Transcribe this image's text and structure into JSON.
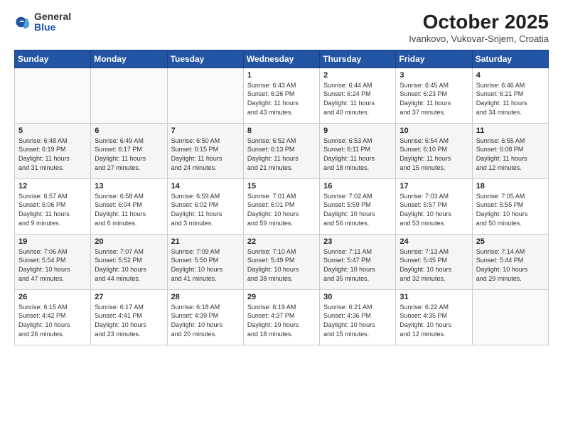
{
  "logo": {
    "general": "General",
    "blue": "Blue"
  },
  "title": "October 2025",
  "subtitle": "Ivankovo, Vukovar-Srijem, Croatia",
  "days_of_week": [
    "Sunday",
    "Monday",
    "Tuesday",
    "Wednesday",
    "Thursday",
    "Friday",
    "Saturday"
  ],
  "weeks": [
    [
      {
        "day": "",
        "info": ""
      },
      {
        "day": "",
        "info": ""
      },
      {
        "day": "",
        "info": ""
      },
      {
        "day": "1",
        "info": "Sunrise: 6:43 AM\nSunset: 6:26 PM\nDaylight: 11 hours\nand 43 minutes."
      },
      {
        "day": "2",
        "info": "Sunrise: 6:44 AM\nSunset: 6:24 PM\nDaylight: 11 hours\nand 40 minutes."
      },
      {
        "day": "3",
        "info": "Sunrise: 6:45 AM\nSunset: 6:23 PM\nDaylight: 11 hours\nand 37 minutes."
      },
      {
        "day": "4",
        "info": "Sunrise: 6:46 AM\nSunset: 6:21 PM\nDaylight: 11 hours\nand 34 minutes."
      }
    ],
    [
      {
        "day": "5",
        "info": "Sunrise: 6:48 AM\nSunset: 6:19 PM\nDaylight: 11 hours\nand 31 minutes."
      },
      {
        "day": "6",
        "info": "Sunrise: 6:49 AM\nSunset: 6:17 PM\nDaylight: 11 hours\nand 27 minutes."
      },
      {
        "day": "7",
        "info": "Sunrise: 6:50 AM\nSunset: 6:15 PM\nDaylight: 11 hours\nand 24 minutes."
      },
      {
        "day": "8",
        "info": "Sunrise: 6:52 AM\nSunset: 6:13 PM\nDaylight: 11 hours\nand 21 minutes."
      },
      {
        "day": "9",
        "info": "Sunrise: 6:53 AM\nSunset: 6:11 PM\nDaylight: 11 hours\nand 18 minutes."
      },
      {
        "day": "10",
        "info": "Sunrise: 6:54 AM\nSunset: 6:10 PM\nDaylight: 11 hours\nand 15 minutes."
      },
      {
        "day": "11",
        "info": "Sunrise: 6:55 AM\nSunset: 6:08 PM\nDaylight: 11 hours\nand 12 minutes."
      }
    ],
    [
      {
        "day": "12",
        "info": "Sunrise: 6:57 AM\nSunset: 6:06 PM\nDaylight: 11 hours\nand 9 minutes."
      },
      {
        "day": "13",
        "info": "Sunrise: 6:58 AM\nSunset: 6:04 PM\nDaylight: 11 hours\nand 6 minutes."
      },
      {
        "day": "14",
        "info": "Sunrise: 6:59 AM\nSunset: 6:02 PM\nDaylight: 11 hours\nand 3 minutes."
      },
      {
        "day": "15",
        "info": "Sunrise: 7:01 AM\nSunset: 6:01 PM\nDaylight: 10 hours\nand 59 minutes."
      },
      {
        "day": "16",
        "info": "Sunrise: 7:02 AM\nSunset: 5:59 PM\nDaylight: 10 hours\nand 56 minutes."
      },
      {
        "day": "17",
        "info": "Sunrise: 7:03 AM\nSunset: 5:57 PM\nDaylight: 10 hours\nand 53 minutes."
      },
      {
        "day": "18",
        "info": "Sunrise: 7:05 AM\nSunset: 5:55 PM\nDaylight: 10 hours\nand 50 minutes."
      }
    ],
    [
      {
        "day": "19",
        "info": "Sunrise: 7:06 AM\nSunset: 5:54 PM\nDaylight: 10 hours\nand 47 minutes."
      },
      {
        "day": "20",
        "info": "Sunrise: 7:07 AM\nSunset: 5:52 PM\nDaylight: 10 hours\nand 44 minutes."
      },
      {
        "day": "21",
        "info": "Sunrise: 7:09 AM\nSunset: 5:50 PM\nDaylight: 10 hours\nand 41 minutes."
      },
      {
        "day": "22",
        "info": "Sunrise: 7:10 AM\nSunset: 5:49 PM\nDaylight: 10 hours\nand 38 minutes."
      },
      {
        "day": "23",
        "info": "Sunrise: 7:11 AM\nSunset: 5:47 PM\nDaylight: 10 hours\nand 35 minutes."
      },
      {
        "day": "24",
        "info": "Sunrise: 7:13 AM\nSunset: 5:45 PM\nDaylight: 10 hours\nand 32 minutes."
      },
      {
        "day": "25",
        "info": "Sunrise: 7:14 AM\nSunset: 5:44 PM\nDaylight: 10 hours\nand 29 minutes."
      }
    ],
    [
      {
        "day": "26",
        "info": "Sunrise: 6:15 AM\nSunset: 4:42 PM\nDaylight: 10 hours\nand 26 minutes."
      },
      {
        "day": "27",
        "info": "Sunrise: 6:17 AM\nSunset: 4:41 PM\nDaylight: 10 hours\nand 23 minutes."
      },
      {
        "day": "28",
        "info": "Sunrise: 6:18 AM\nSunset: 4:39 PM\nDaylight: 10 hours\nand 20 minutes."
      },
      {
        "day": "29",
        "info": "Sunrise: 6:19 AM\nSunset: 4:37 PM\nDaylight: 10 hours\nand 18 minutes."
      },
      {
        "day": "30",
        "info": "Sunrise: 6:21 AM\nSunset: 4:36 PM\nDaylight: 10 hours\nand 15 minutes."
      },
      {
        "day": "31",
        "info": "Sunrise: 6:22 AM\nSunset: 4:35 PM\nDaylight: 10 hours\nand 12 minutes."
      },
      {
        "day": "",
        "info": ""
      }
    ]
  ]
}
